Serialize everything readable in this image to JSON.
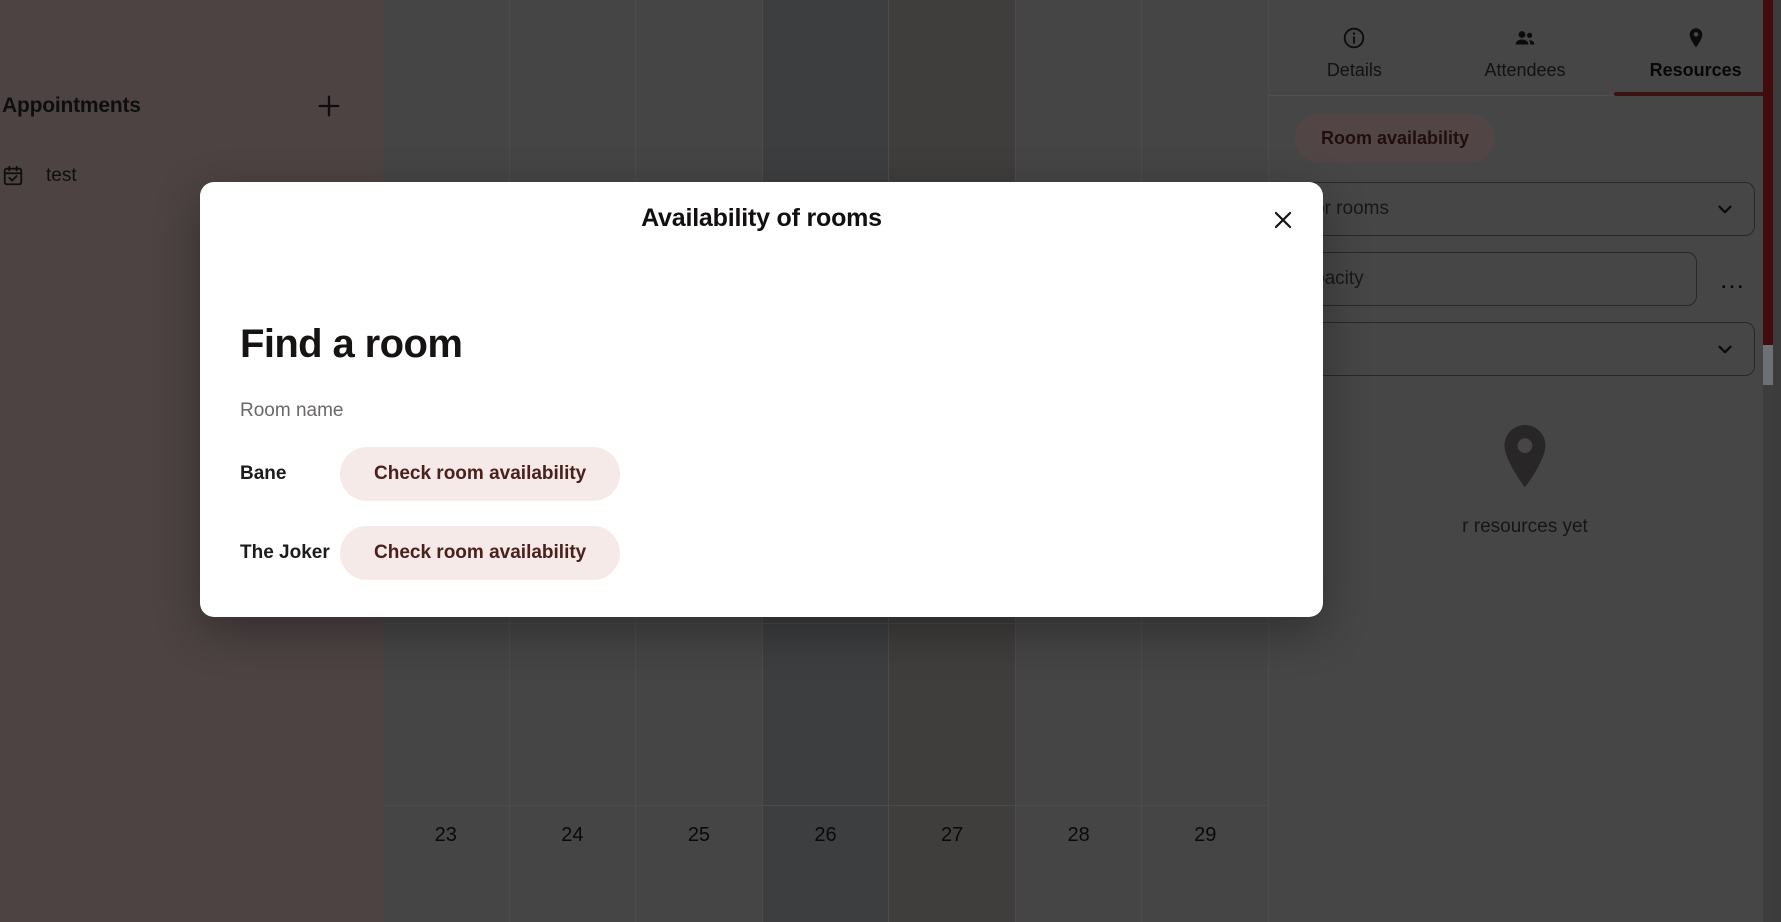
{
  "left_sidebar": {
    "title": "Appointments",
    "add_icon": "plus-icon",
    "items": [
      {
        "label": "test",
        "icon": "calendar-check-icon"
      }
    ]
  },
  "calendar": {
    "dates": [
      "23",
      "24",
      "25",
      "26",
      "27",
      "28",
      "29"
    ]
  },
  "right_panel": {
    "tabs": [
      {
        "label": "Details",
        "icon": "info-circle-icon",
        "active": false
      },
      {
        "label": "Attendees",
        "icon": "people-icon",
        "active": false
      },
      {
        "label": "Resources",
        "icon": "location-pin-icon",
        "active": true
      }
    ],
    "room_availability_label": "Room availability",
    "search_rooms_value": "or rooms",
    "capacity_value": "pacity",
    "third_field_value": "",
    "more_icon": "ellipsis-icon",
    "empty_state": {
      "icon": "location-pin-icon",
      "text": "r resources yet"
    }
  },
  "modal": {
    "title": "Availability of rooms",
    "close_icon": "close-icon",
    "heading": "Find a room",
    "column_header": "Room name",
    "rows": [
      {
        "room": "Bane",
        "button_label": "Check room availability"
      },
      {
        "room": "The Joker",
        "button_label": "Check room availability"
      }
    ]
  },
  "colors": {
    "accent": "#6b2420",
    "button_bg": "#f5eae7",
    "button_text": "#4a211c",
    "modal_bg": "#ffffff"
  }
}
